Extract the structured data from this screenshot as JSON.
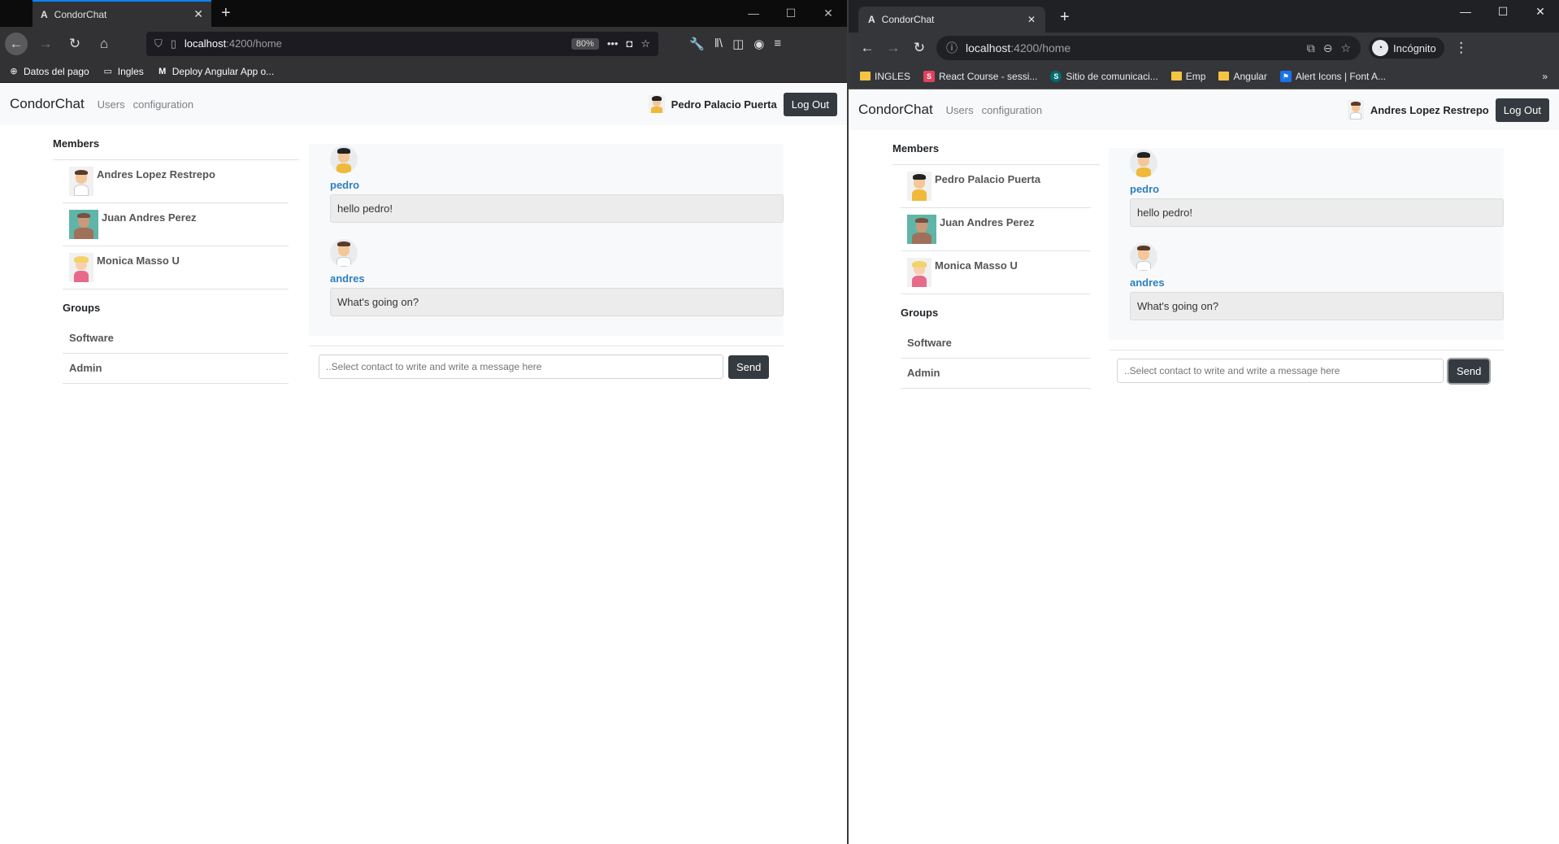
{
  "left": {
    "browser": {
      "tab_title": "CondorChat",
      "url_host": "localhost",
      "url_path": ":4200/home",
      "zoom": "80%",
      "bookmarks": [
        "Datos del pago",
        "Ingles",
        "Deploy Angular App o..."
      ]
    },
    "app": {
      "brand": "CondorChat",
      "nav_users": "Users",
      "nav_configuration": "configuration",
      "current_user": "Pedro Palacio Puerta",
      "logout": "Log Out",
      "members_title": "Members",
      "members": [
        "Andres Lopez Restrepo",
        "Juan Andres Perez",
        "Monica Masso U"
      ],
      "groups_title": "Groups",
      "groups": [
        "Software",
        "Admin"
      ],
      "messages": [
        {
          "author": "pedro",
          "text": "hello pedro!"
        },
        {
          "author": "andres",
          "text": "What's going on?"
        }
      ],
      "input_placeholder": "..Select contact to write and write a message here",
      "send": "Send"
    }
  },
  "right": {
    "browser": {
      "tab_title": "CondorChat",
      "url_host": "localhost",
      "url_path": ":4200/home",
      "incognito": "Incógnito",
      "bookmarks": [
        "INGLES",
        "React Course - sessi...",
        "Sitio de comunicaci...",
        "Emp",
        "Angular",
        "Alert Icons | Font A..."
      ]
    },
    "app": {
      "brand": "CondorChat",
      "nav_users": "Users",
      "nav_configuration": "configuration",
      "current_user": "Andres Lopez Restrepo",
      "logout": "Log Out",
      "members_title": "Members",
      "members": [
        "Pedro Palacio Puerta",
        "Juan Andres Perez",
        "Monica Masso U"
      ],
      "groups_title": "Groups",
      "groups": [
        "Software",
        "Admin"
      ],
      "messages": [
        {
          "author": "pedro",
          "text": "hello pedro!"
        },
        {
          "author": "andres",
          "text": "What's going on?"
        }
      ],
      "input_placeholder": "..Select contact to write and write a message here",
      "send": "Send"
    }
  },
  "colors": {
    "author_link": "#2c7fc0",
    "dark_button": "#343a40",
    "firefox_accent": "#0a84ff"
  }
}
